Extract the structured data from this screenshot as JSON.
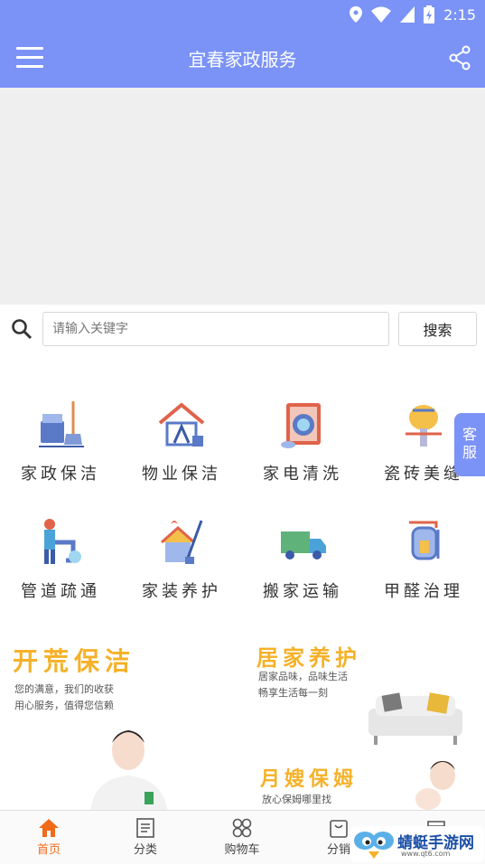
{
  "status": {
    "time": "2:15"
  },
  "header": {
    "title": "宜春家政服务"
  },
  "search": {
    "placeholder": "请输入关键字",
    "button": "搜索"
  },
  "categories": [
    {
      "label": "家政保洁",
      "icon": "cleaning-bucket-icon"
    },
    {
      "label": "物业保洁",
      "icon": "property-house-icon"
    },
    {
      "label": "家电清洗",
      "icon": "washing-machine-icon"
    },
    {
      "label": "瓷砖美缝",
      "icon": "tile-grout-icon"
    },
    {
      "label": "管道疏通",
      "icon": "pipe-unclog-icon"
    },
    {
      "label": "家装养护",
      "icon": "house-care-icon"
    },
    {
      "label": "搬家运输",
      "icon": "moving-truck-icon"
    },
    {
      "label": "甲醛治理",
      "icon": "formaldehyde-icon"
    }
  ],
  "side_button": {
    "line1": "客",
    "line2": "服"
  },
  "promos": [
    {
      "title": "开荒保洁",
      "line1": "您的满意，我们的收获",
      "line2": "用心服务，值得您信赖"
    },
    {
      "title": "居家养护",
      "line1": "居家品味，品味生活",
      "line2": "畅享生活每一刻"
    },
    {
      "title": "月嫂保姆",
      "line1": "放心保姆哪里找",
      "line2": ""
    }
  ],
  "tabs": [
    {
      "label": "首页",
      "icon": "home-icon"
    },
    {
      "label": "分类",
      "icon": "category-icon"
    },
    {
      "label": "购物车",
      "icon": "cart-icon"
    },
    {
      "label": "分销",
      "icon": "bag-icon"
    },
    {
      "label": "",
      "icon": "store-icon"
    }
  ],
  "watermark": {
    "text": "蜻蜓手游网",
    "url": "www.qt6.com"
  },
  "colors": {
    "primary": "#7b93f7",
    "accent": "#f06a1a",
    "promo": "#f5b128"
  }
}
